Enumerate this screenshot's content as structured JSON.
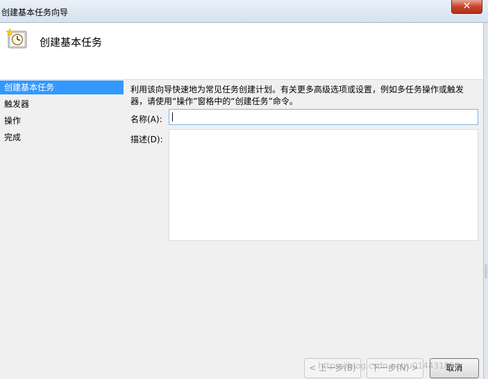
{
  "window": {
    "title": "创建基本任务向导",
    "close_label": "✕"
  },
  "header": {
    "heading": "创建基本任务",
    "icon": "clock-task-icon"
  },
  "nav": {
    "items": [
      {
        "label": "创建基本任务",
        "active": true
      },
      {
        "label": "触发器",
        "active": false
      },
      {
        "label": "操作",
        "active": false
      },
      {
        "label": "完成",
        "active": false
      }
    ]
  },
  "content": {
    "intro_line1": "利用该向导快速地为常见任务创建计划。有关更多高级选项或设置，例如多任务操作或触发",
    "intro_line2": "器，请使用“操作”窗格中的“创建任务”命令。",
    "name_label": "名称(A):",
    "name_value": "",
    "description_label": "描述(D):",
    "description_value": ""
  },
  "buttons": {
    "back_label": "< 上一步(B)",
    "next_label": "下一步(N) >",
    "cancel_label": "取消"
  },
  "watermark": "https://blog.csdn.net/u014431852"
}
